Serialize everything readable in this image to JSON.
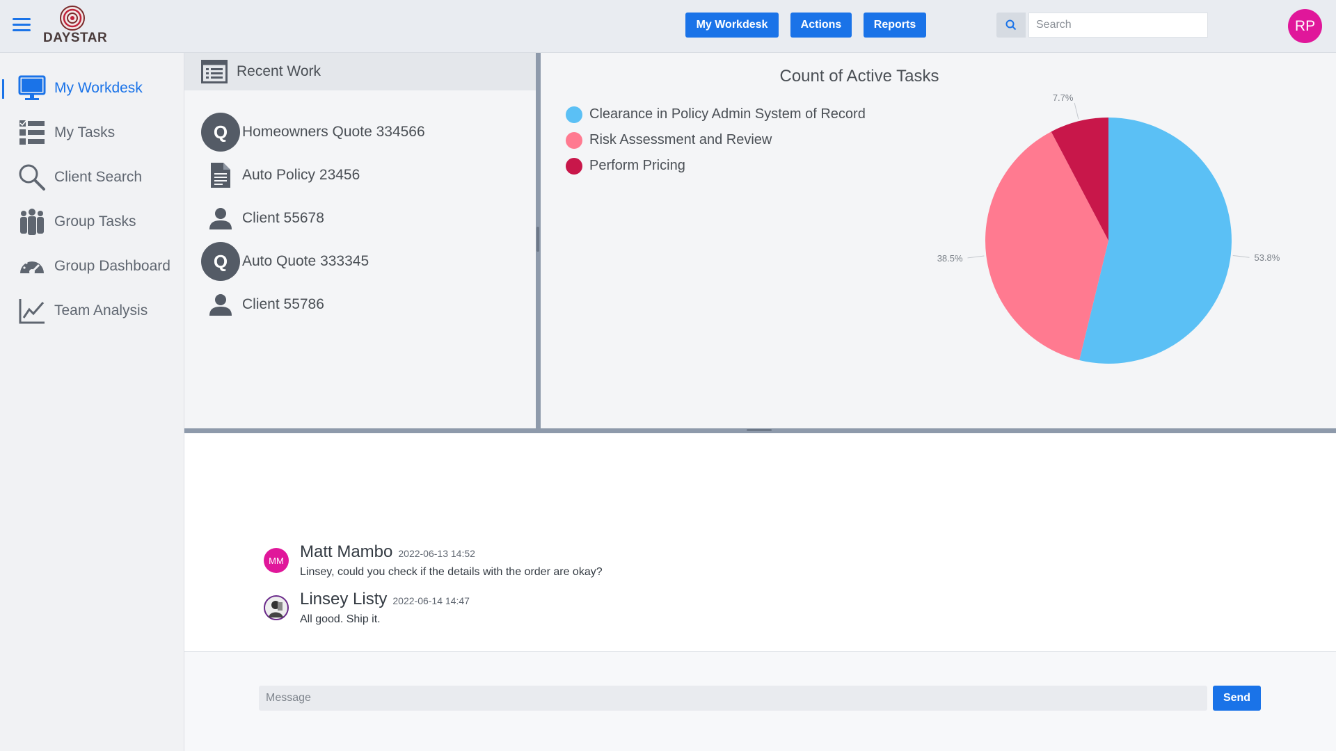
{
  "header": {
    "logo_text": "DAYSTAR",
    "buttons": [
      "My Workdesk",
      "Actions",
      "Reports"
    ],
    "search_placeholder": "Search",
    "user_initials": "RP",
    "colors": {
      "primary": "#1a73e8",
      "avatar": "#e0179a"
    }
  },
  "sidebar": {
    "items": [
      {
        "label": "My Workdesk",
        "icon": "monitor-icon",
        "active": true
      },
      {
        "label": "My Tasks",
        "icon": "task-list-icon"
      },
      {
        "label": "Client Search",
        "icon": "search-icon"
      },
      {
        "label": "Group Tasks",
        "icon": "group-icon"
      },
      {
        "label": "Group Dashboard",
        "icon": "gauge-icon"
      },
      {
        "label": "Team Analysis",
        "icon": "line-chart-icon"
      }
    ]
  },
  "recent_work": {
    "title": "Recent Work",
    "items": [
      {
        "label": "Homeowners Quote 334566",
        "icon": "quote-badge-icon",
        "badge": "Q"
      },
      {
        "label": "Auto Policy 23456",
        "icon": "document-icon"
      },
      {
        "label": "Client 55678",
        "icon": "person-icon"
      },
      {
        "label": "Auto Quote 333345",
        "icon": "quote-badge-icon",
        "badge": "Q"
      },
      {
        "label": "Client 55786",
        "icon": "person-icon"
      }
    ]
  },
  "chart_data": {
    "type": "pie",
    "title": "Count of Active Tasks",
    "legend_position": "top-left",
    "slices": [
      {
        "label": "Clearance in Policy Admin System of Record",
        "value": 53.8,
        "color": "#5bc0f5",
        "data_label": "53.8%"
      },
      {
        "label": "Risk Assessment and Review",
        "value": 38.5,
        "color": "#ff7a90",
        "data_label": "38.5%"
      },
      {
        "label": "Perform Pricing",
        "value": 7.7,
        "color": "#c8174a",
        "data_label": "7.7%"
      }
    ]
  },
  "chat": {
    "messages": [
      {
        "initials": "MM",
        "name": "Matt Mambo",
        "time": "2022-06-13 14:52",
        "text": "Linsey, could you check if the details with the order are okay?",
        "avatar_color": "#e0179a"
      },
      {
        "initials": "",
        "name": "Linsey Listy",
        "time": "2022-06-14 14:47",
        "text": "All good.  Ship it.",
        "avatar_color": "#3a2a4a"
      }
    ],
    "input_placeholder": "Message",
    "send_label": "Send"
  }
}
